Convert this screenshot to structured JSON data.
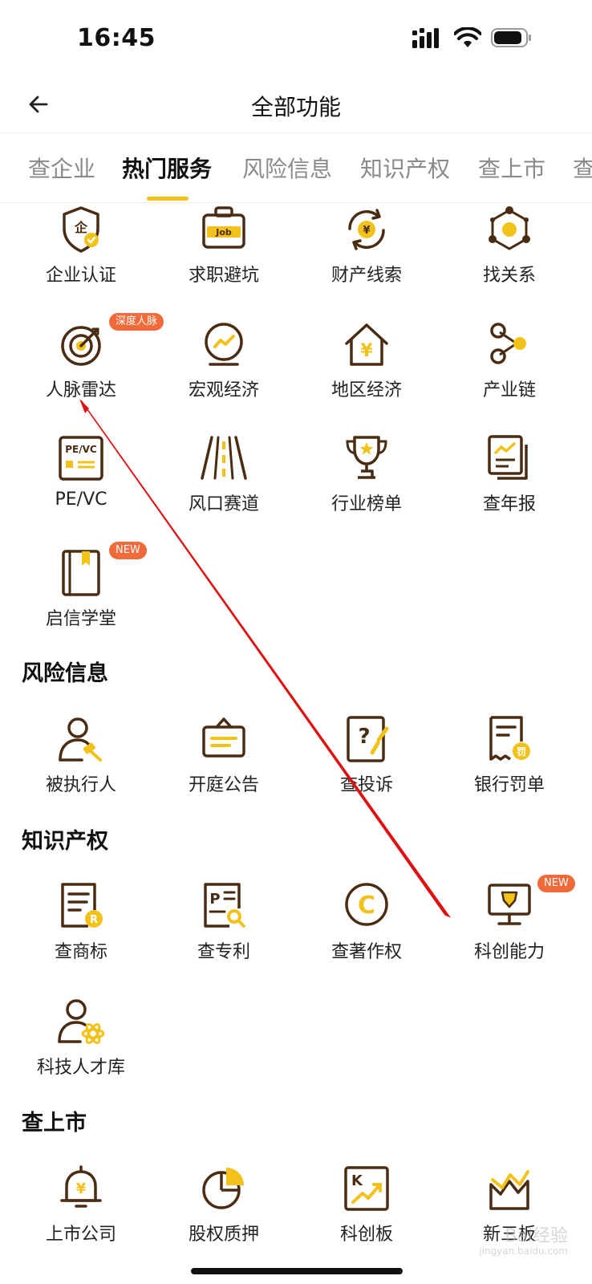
{
  "status_bar": {
    "time": "16:45"
  },
  "nav": {
    "title": "全部功能"
  },
  "tabs": [
    {
      "label": "查企业"
    },
    {
      "label": "热门服务"
    },
    {
      "label": "风险信息"
    },
    {
      "label": "知识产权"
    },
    {
      "label": "查上市"
    },
    {
      "label": "查"
    }
  ],
  "hot_services": {
    "items": [
      {
        "label": "企业认证",
        "icon": "shield-enterprise-icon"
      },
      {
        "label": "求职避坑",
        "icon": "job-briefcase-icon"
      },
      {
        "label": "财产线索",
        "icon": "property-clue-icon"
      },
      {
        "label": "找关系",
        "icon": "relation-network-icon"
      },
      {
        "label": "人脉雷达",
        "icon": "radar-target-icon",
        "badge": "深度人脉"
      },
      {
        "label": "宏观经济",
        "icon": "macro-economy-icon"
      },
      {
        "label": "地区经济",
        "icon": "regional-economy-icon"
      },
      {
        "label": "产业链",
        "icon": "industry-chain-icon"
      },
      {
        "label": "PE/VC",
        "icon": "pe-vc-icon",
        "icon_text": "PE/VC"
      },
      {
        "label": "风口赛道",
        "icon": "race-track-icon"
      },
      {
        "label": "行业榜单",
        "icon": "trophy-icon"
      },
      {
        "label": "查年报",
        "icon": "annual-report-icon"
      },
      {
        "label": "启信学堂",
        "icon": "book-icon",
        "badge": "NEW"
      }
    ]
  },
  "risk": {
    "title": "风险信息",
    "items": [
      {
        "label": "被执行人",
        "icon": "executed-person-icon"
      },
      {
        "label": "开庭公告",
        "icon": "court-notice-icon"
      },
      {
        "label": "查投诉",
        "icon": "complaint-icon"
      },
      {
        "label": "银行罚单",
        "icon": "bank-fine-icon",
        "icon_text": "罚"
      }
    ]
  },
  "ip": {
    "title": "知识产权",
    "items": [
      {
        "label": "查商标",
        "icon": "trademark-icon",
        "icon_text": "R"
      },
      {
        "label": "查专利",
        "icon": "patent-icon",
        "icon_text": "P"
      },
      {
        "label": "查著作权",
        "icon": "copyright-icon",
        "icon_text": "C"
      },
      {
        "label": "科创能力",
        "icon": "innovation-monitor-icon",
        "badge": "NEW"
      },
      {
        "label": "科技人才库",
        "icon": "tech-talent-icon"
      }
    ]
  },
  "listed": {
    "title": "查上市",
    "items": [
      {
        "label": "上市公司",
        "icon": "listed-bell-icon",
        "icon_text": "¥"
      },
      {
        "label": "股权质押",
        "icon": "pie-chart-icon"
      },
      {
        "label": "科创板",
        "icon": "star-board-icon",
        "icon_text": "K"
      },
      {
        "label": "新三板",
        "icon": "new-third-board-icon"
      }
    ]
  },
  "watermark": {
    "text": "Bai经验",
    "sub": "jingyan.baidu.com"
  },
  "colors": {
    "accent": "#f2c21b",
    "icon_brown": "#4a2c12",
    "badge": "#f06a3a",
    "annotation": "#e01010"
  }
}
